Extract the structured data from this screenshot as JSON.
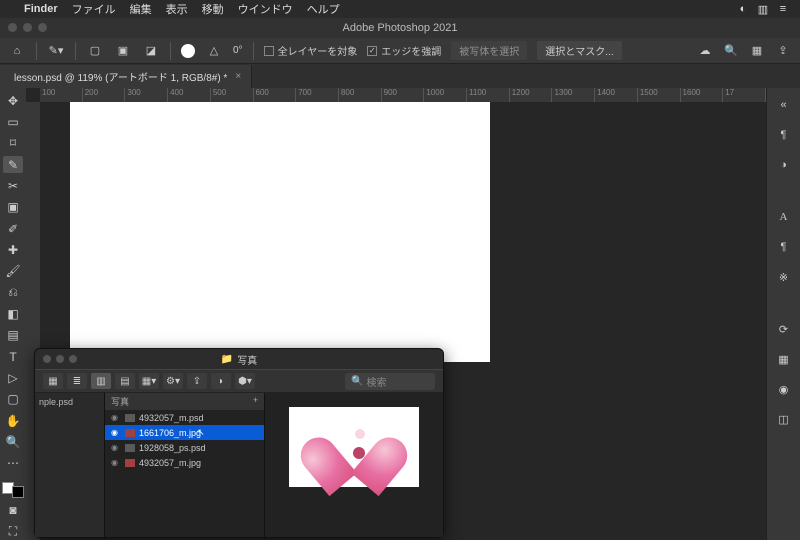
{
  "mac_menu": {
    "app": "Finder",
    "items": [
      "ファイル",
      "編集",
      "表示",
      "移動",
      "ウインドウ",
      "ヘルプ"
    ]
  },
  "window": {
    "title": "Adobe Photoshop 2021"
  },
  "options": {
    "angle_label": "0°",
    "all_layers": "全レイヤーを対象",
    "enhance_edge": "エッジを強調",
    "refine_label": "被写体を選択",
    "mask_label": "選択とマスク..."
  },
  "tab": {
    "label": "lesson.psd @ 119% (アートボード 1, RGB/8#) *"
  },
  "ruler": [
    "100",
    "200",
    "300",
    "400",
    "500",
    "600",
    "700",
    "800",
    "900",
    "1000",
    "1100",
    "1200",
    "1300",
    "1400",
    "1500",
    "1600",
    "17"
  ],
  "finder": {
    "title": "写真",
    "search_placeholder": "検索",
    "col_header": "写真",
    "sidebar_item": "nple.psd",
    "rows": [
      {
        "name": "4932057_m.psd",
        "type": "psd",
        "sel": false
      },
      {
        "name": "1661706_m.jpg",
        "type": "jpg",
        "sel": true
      },
      {
        "name": "1928058_ps.psd",
        "type": "psd",
        "sel": false
      },
      {
        "name": "4932057_m.jpg",
        "type": "jpg",
        "sel": false
      }
    ]
  }
}
